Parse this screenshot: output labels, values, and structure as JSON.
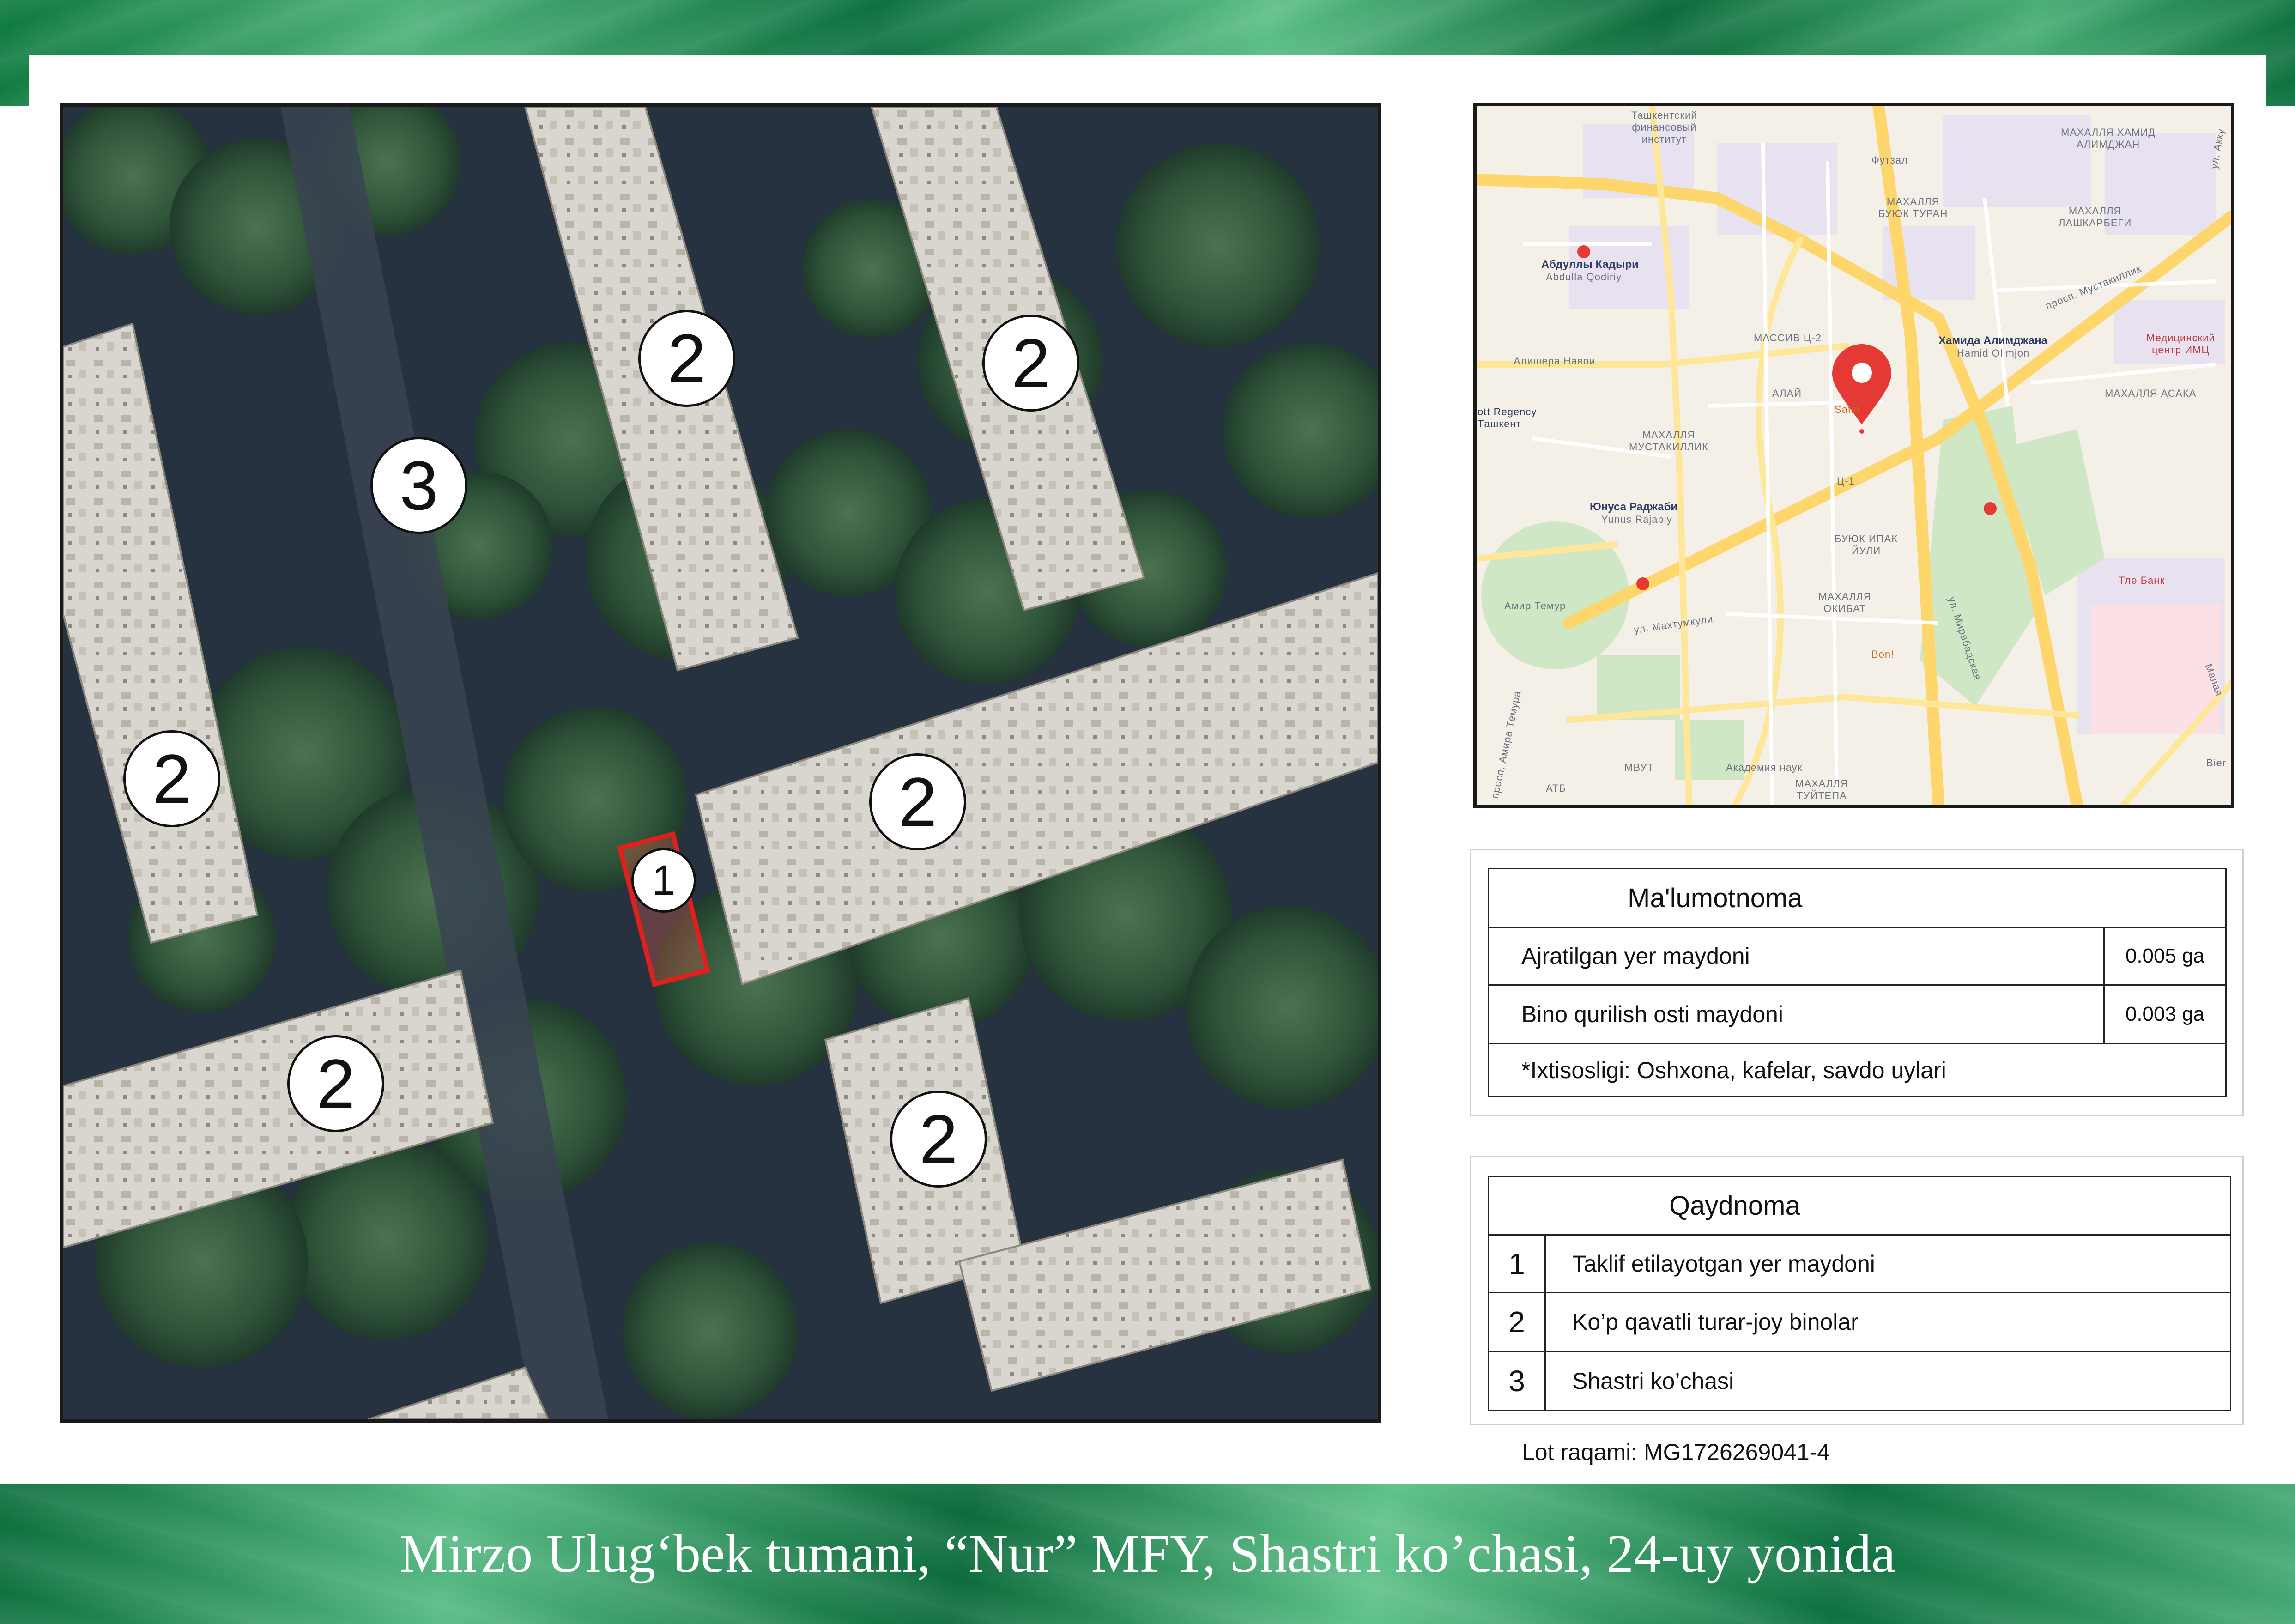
{
  "title": "Mirzo Ulug‘bek tumani, “Nur” MFY, Shastri ko’chasi, 24-uy yonida",
  "satellite": {
    "markers": [
      {
        "label": "2"
      },
      {
        "label": "2"
      },
      {
        "label": "3"
      },
      {
        "label": "2"
      },
      {
        "label": "2"
      },
      {
        "label": "1"
      },
      {
        "label": "2"
      },
      {
        "label": "2"
      }
    ]
  },
  "city_map": {
    "labels": {
      "l1": "Ташкентский\nфинансовый\nинститут",
      "l2": "МАХАЛЛЯ ХАМИД\nАЛИМДЖАН",
      "l3": "Футзал",
      "l4": "МАХАЛЛЯ\nБУЮК ТУРАН",
      "l5": "Абдуллы Кадыри",
      "l6": "Abdulla Qodiriy",
      "l7": "МАХАЛЛЯ\nЛАШКАРБЕГИ",
      "l8": "просп. Мустакиллик",
      "l9": "Хамида Алимджана",
      "l10": "Hamid Olimjon",
      "l11": "Медицинский\nцентр ИМЦ",
      "l12": "МАССИВ Ц-2",
      "l13": "Алишера Навои",
      "l14": "АЛАЙ",
      "l15": "Safia",
      "l16": "МАХАЛЛЯ АСАКА",
      "l17": "ott Regency\nTашкент",
      "l18": "МАХАЛЛЯ\nМУСТАКИЛЛИК",
      "l19": "Ц-1",
      "l20": "Юнуса Раджаби",
      "l21": "Yunus Rajabiy",
      "l22": "БУЮК ИПАК\nЙУЛИ",
      "l23": "Амир Темур",
      "l24": "МАХАЛЛЯ\nОКИБАТ",
      "l25": "ул. Махтумкули",
      "l26": "Тле Банк",
      "l27": "Bon!",
      "l28": "просп. Амира Темура",
      "l29": "МВУТ",
      "l30": "Академия наук",
      "l31": "АТБ",
      "l32": "МАХАЛЛЯ\nТУЙТЕПА",
      "l33": "Bier",
      "l34": "ул. Мирабадская",
      "l35": "ул. Акку",
      "l36": "Малая"
    }
  },
  "info_table": {
    "heading": "Ma'lumotnoma",
    "rows": [
      {
        "label": "Ajratilgan yer maydoni",
        "value": "0.005 ga"
      },
      {
        "label": "Bino qurilish osti maydoni",
        "value": "0.003 ga"
      }
    ],
    "note": "*Ixtisosligi: Oshxona, kafelar, savdo uylari"
  },
  "legend": {
    "heading": "Qaydnoma",
    "items": [
      {
        "num": "1",
        "text": "Taklif etilayotgan yer maydoni"
      },
      {
        "num": "2",
        "text": "Ko’p qavatli turar-joy binolar"
      },
      {
        "num": "3",
        "text": "Shastri ko’chasi"
      }
    ]
  },
  "lot_number": "Lot raqami: MG1726269041-4",
  "colors": {
    "banner_green": "#0d7040",
    "plot_outline": "#e0201c",
    "map_pin": "#e53935"
  }
}
